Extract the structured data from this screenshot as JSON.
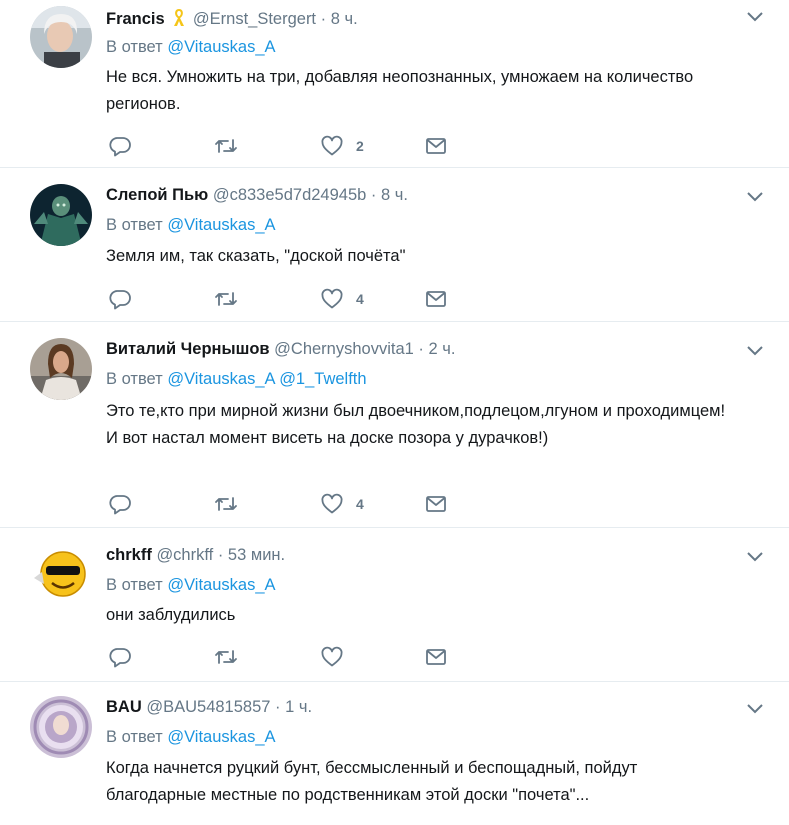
{
  "reply_prefix": "В ответ",
  "tweets": [
    {
      "name": "Francis",
      "handle": "@Ernst_Stergert",
      "dot": "·",
      "time": "8 ч.",
      "reply_to": [
        "@Vitauskas_A"
      ],
      "text": [
        "Не вся. Умножить на три, добавляя неопознанных, умножаем на количество регионов."
      ],
      "likes": "2",
      "has_badge": true
    },
    {
      "name": "Слепой Пью",
      "handle": "@c833e5d7d24945b",
      "dot": "·",
      "time": "8 ч.",
      "reply_to": [
        "@Vitauskas_A"
      ],
      "text": [
        "Земля им, так сказать, \"доской почёта\""
      ],
      "likes": "4"
    },
    {
      "name": "Виталий Чернышов",
      "handle": "@Chernyshovvita1",
      "dot": "·",
      "time": "2 ч.",
      "reply_to": [
        "@Vitauskas_A",
        "@1_Twelfth"
      ],
      "text": [
        "Это те,кто при мирной жизни был двоечником,подлецом,лгуном и проходимцем!",
        "И вот настал момент висеть на доске позора у дурачков!)"
      ],
      "likes": "4"
    },
    {
      "name": "chrkff",
      "handle": "@chrkff",
      "dot": "·",
      "time": "53 мин.",
      "reply_to": [
        "@Vitauskas_A"
      ],
      "text": [
        "они заблудились"
      ],
      "likes": ""
    },
    {
      "name": "BAU",
      "handle": "@BAU54815857",
      "dot": "·",
      "time": "1 ч.",
      "reply_to": [
        "@Vitauskas_A"
      ],
      "text": [
        "Когда начнется руцкий бунт, бессмысленный и беспощадный, пойдут благодарные местные по родственникам этой доски \"почета\"..."
      ],
      "likes": ""
    }
  ],
  "icons": {
    "reply": "reply-icon",
    "retweet": "retweet-icon",
    "like": "heart-icon",
    "dm": "envelope-icon",
    "more": "chevron-down-icon",
    "badge": "yellow-ribbon-icon"
  },
  "colors": {
    "link": "#1b95e0",
    "secondary": "#657786",
    "divider": "#e6ecf0",
    "ribbon": "#f5c518"
  }
}
